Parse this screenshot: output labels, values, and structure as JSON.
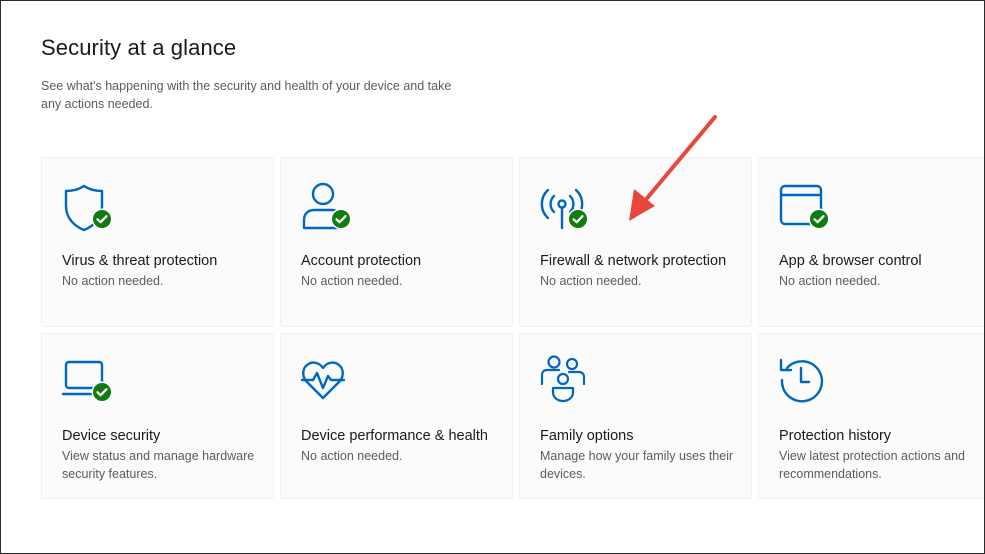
{
  "page": {
    "title": "Security at a glance",
    "subtitle": "See what's happening with the security and health of your device and take any actions needed."
  },
  "colors": {
    "accent": "#0067c0",
    "ok": "#107c10",
    "annotation_arrow": "#e8473b"
  },
  "tiles": [
    {
      "title": "Virus & threat protection",
      "status": "No action needed.",
      "icon": "shield-icon",
      "badge": "check-badge-icon"
    },
    {
      "title": "Account protection",
      "status": "No action needed.",
      "icon": "person-icon",
      "badge": "check-badge-icon"
    },
    {
      "title": "Firewall & network protection",
      "status": "No action needed.",
      "icon": "antenna-icon",
      "badge": "check-badge-icon"
    },
    {
      "title": "App & browser control",
      "status": "No action needed.",
      "icon": "browser-window-icon",
      "badge": "check-badge-icon"
    },
    {
      "title": "Device security",
      "status": "View status and manage hardware security features.",
      "icon": "laptop-icon",
      "badge": "check-badge-icon"
    },
    {
      "title": "Device performance & health",
      "status": "No action needed.",
      "icon": "heart-pulse-icon"
    },
    {
      "title": "Family options",
      "status": "Manage how your family uses their devices.",
      "icon": "family-icon"
    },
    {
      "title": "Protection history",
      "status": "View latest protection actions and recommendations.",
      "icon": "history-clock-icon"
    }
  ]
}
